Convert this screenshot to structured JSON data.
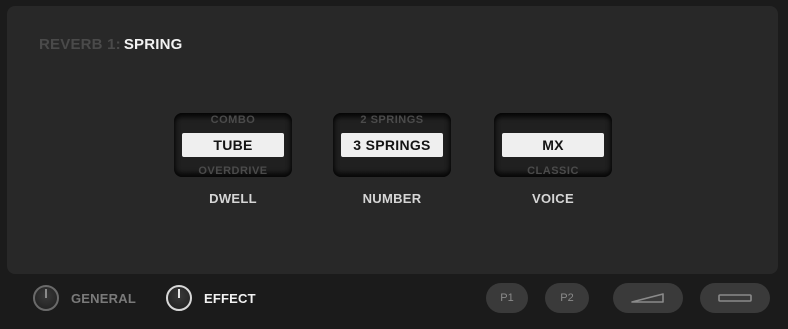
{
  "header": {
    "prefix": "REVERB 1:",
    "name": "SPRING"
  },
  "params": [
    {
      "above": "COMBO",
      "value": "TUBE",
      "below": "OVERDRIVE",
      "label": "DWELL"
    },
    {
      "above": "2 SPRINGS",
      "value": "3 SPRINGS",
      "below": "",
      "label": "NUMBER"
    },
    {
      "above": "",
      "value": "MX",
      "below": "CLASSIC",
      "label": "VOICE"
    }
  ],
  "footer": {
    "general_label": "GENERAL",
    "effect_label": "EFFECT",
    "p1_label": "P1",
    "p2_label": "P2",
    "pedal_icon": "expression-pedal-icon",
    "flat_icon": "flat-pedal-icon"
  },
  "colors": {
    "background": "#1b1b1b",
    "panel": "#282828",
    "pill": "#efefef",
    "button": "#3a3a3a"
  }
}
